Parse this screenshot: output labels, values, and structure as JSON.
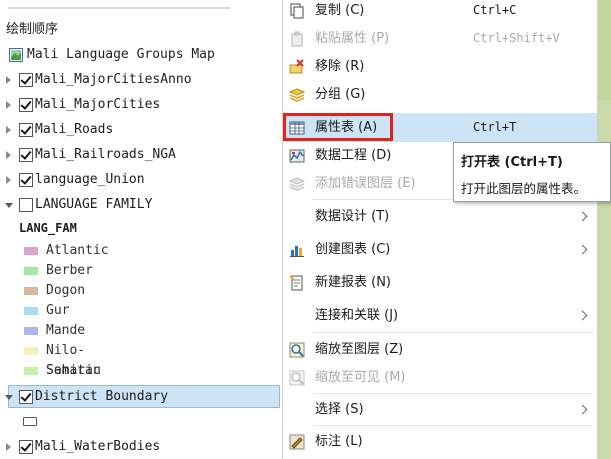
{
  "pane": {
    "title": "绘制顺序",
    "map_name": "Mali Language Groups Map",
    "layers": [
      {
        "name": "Mali_MajorCitiesAnno",
        "checked": true,
        "expanded": false
      },
      {
        "name": "Mali_MajorCities",
        "checked": true,
        "expanded": false
      },
      {
        "name": "Mali_Roads",
        "checked": true,
        "expanded": false
      },
      {
        "name": "Mali_Railroads_NGA",
        "checked": true,
        "expanded": false
      },
      {
        "name": "language_Union",
        "checked": true,
        "expanded": false
      },
      {
        "name": "LANGUAGE FAMILY",
        "checked": false,
        "expanded": true
      },
      {
        "name": "District Boundary",
        "checked": true,
        "expanded": true,
        "selected": true
      },
      {
        "name": "Mali_WaterBodies",
        "checked": true,
        "expanded": false
      }
    ],
    "legend_heading": "LANG_FAM",
    "legend": [
      {
        "label": "Atlantic",
        "color": "#d9a6cf"
      },
      {
        "label": "Berber",
        "color": "#a3e8a3"
      },
      {
        "label": "Dogon",
        "color": "#d9b89a"
      },
      {
        "label": "Gur",
        "color": "#a7dcf3"
      },
      {
        "label": "Mande",
        "color": "#a9b7ee"
      },
      {
        "label": "Nilo-Saharan",
        "color": "#f3f1b3"
      },
      {
        "label": "Semitic",
        "color": "#c6f0a9"
      }
    ]
  },
  "menu": {
    "items": [
      {
        "label": "复制 (C)",
        "shortcut": "Ctrl+C",
        "icon": "copy-icon",
        "disabled": false
      },
      {
        "label": "粘贴属性 (P)",
        "shortcut": "Ctrl+Shift+V",
        "icon": "paste-icon",
        "disabled": true
      },
      {
        "label": "移除 (R)",
        "shortcut": "",
        "icon": "remove-icon",
        "disabled": false
      },
      {
        "label": "分组 (G)",
        "shortcut": "",
        "icon": "group-icon",
        "disabled": false
      },
      {
        "label": "属性表 (A)",
        "shortcut": "Ctrl+T",
        "icon": "table-icon",
        "disabled": false
      },
      {
        "label": "数据工程 (D)",
        "shortcut": "",
        "icon": "data-engineering-icon",
        "disabled": false
      },
      {
        "label": "添加错误图层 (E)",
        "shortcut": "",
        "icon": "error-layer-icon",
        "disabled": true
      },
      {
        "label": "数据设计 (T)",
        "shortcut": "",
        "icon": "",
        "disabled": false,
        "submenu": true
      },
      {
        "label": "创建图表 (C)",
        "shortcut": "",
        "icon": "chart-icon",
        "disabled": false,
        "submenu": true
      },
      {
        "label": "新建报表 (N)",
        "shortcut": "",
        "icon": "report-icon",
        "disabled": false
      },
      {
        "label": "连接和关联 (J)",
        "shortcut": "",
        "icon": "",
        "disabled": false,
        "submenu": true
      },
      {
        "label": "缩放至图层 (Z)",
        "shortcut": "",
        "icon": "zoom-to-layer-icon",
        "disabled": false
      },
      {
        "label": "缩放至可见 (M)",
        "shortcut": "",
        "icon": "zoom-to-visible-icon",
        "disabled": true
      },
      {
        "label": "选择 (S)",
        "shortcut": "",
        "icon": "",
        "disabled": false,
        "submenu": true
      },
      {
        "label": "标注 (L)",
        "shortcut": "",
        "icon": "label-icon",
        "disabled": false
      }
    ]
  },
  "tooltip": {
    "title": "打开表 (Ctrl+T)",
    "description": "打开此图层的属性表。"
  }
}
